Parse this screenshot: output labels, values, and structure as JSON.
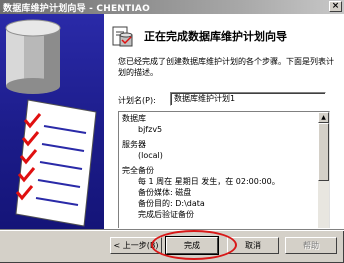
{
  "window": {
    "title": "数据库维护计划向导 - CHENTIAO",
    "close_symbol": "×"
  },
  "wizard": {
    "title": "正在完成数据库维护计划向导",
    "intro": "您已经完成了创建数据库维护计划的各个步骤。下面是列表计划的描述。",
    "name_label": "计划名(P):",
    "name_value": "数据库维护计划1"
  },
  "summary": {
    "lines": [
      "数据库",
      "bjfzv5",
      "服务器",
      "(local)",
      "完全备份",
      "每 1 周在 星期日 发生，在 02:00:00。",
      "备份媒体: 磁盘",
      "备份目的: D:\\data",
      "完成后验证备份"
    ]
  },
  "buttons": {
    "back": "< 上一步(B)",
    "finish": "完成",
    "cancel": "取消",
    "help": "帮助"
  },
  "icons": {
    "close": "close-icon",
    "wizard": "database-wizard-icon",
    "illustration": "database-checklist-illustration"
  },
  "colors": {
    "left_panel": "#1c1c8a",
    "annotation": "#d81818"
  }
}
